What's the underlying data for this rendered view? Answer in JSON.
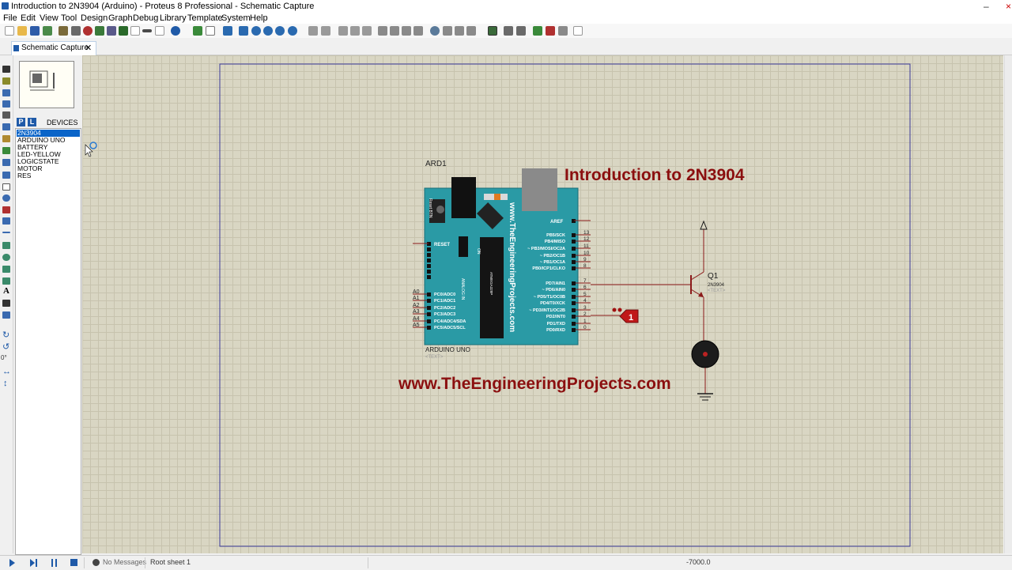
{
  "window": {
    "title": "Introduction to 2N3904 (Arduino) - Proteus 8 Professional - Schematic Capture"
  },
  "menu": [
    "File",
    "Edit",
    "View",
    "Tool",
    "Design",
    "Graph",
    "Debug",
    "Library",
    "Template",
    "System",
    "Help"
  ],
  "tab": {
    "label": "Schematic Capture"
  },
  "panel": {
    "p_label": "P",
    "l_label": "L",
    "devices_title": "DEVICES",
    "devices": [
      "2N3904",
      "ARDUINO UNO",
      "BATTERY",
      "LED-YELLOW",
      "LOGICSTATE",
      "MOTOR",
      "RES"
    ],
    "selected": "2N3904",
    "angle": "0°"
  },
  "schematic": {
    "heading": "Introduction to 2N3904",
    "website": "www.TheEngineeringProjects.com",
    "board_ref": "ARD1",
    "board_name": "ARDUINO UNO",
    "board_text": "<TEXT>",
    "board_vertical_text": "www.TheEngineeringProjects.com",
    "reset_label": "RESET",
    "reset_btn_label": "Reset BTN",
    "on_label": "ON",
    "analog_header": "ANALOG IN",
    "chip_label": "ATMEGA328P",
    "aref": "AREF",
    "digital_labels": [
      "PB5/SCK",
      "PB4/MISO",
      "~ PB3/MOSI/OC2A",
      "~ PB2/OC1B",
      "~ PB1/OC1A",
      "PB0/ICP1/CLKO",
      "PD7/AIN1",
      "~ PD6/AIN0",
      "~ PD5/T1/OC0B",
      "PD4/T0/XCK",
      "~ PD3/INT1/OC2B",
      "PD2/INT0",
      "PD1/TXD",
      "PD0/RXD"
    ],
    "digital_nums": [
      "13",
      "12",
      "11",
      "10",
      "9",
      "8",
      "7",
      "6",
      "5",
      "4",
      "3",
      "2",
      "1",
      "0"
    ],
    "analog_pins": [
      "A0",
      "A1",
      "A2",
      "A3",
      "A4",
      "A5"
    ],
    "analog_labels": [
      "PC0/ADC0",
      "PC1/ADC1",
      "PC2/ADC2",
      "PC3/ADC3",
      "PC4/ADC4/SDA",
      "PC5/ADC5/SCL"
    ],
    "transistor_ref": "Q1",
    "transistor_part": "2N3904",
    "transistor_text": "<TEXT>",
    "logicstate_value": "1"
  },
  "status": {
    "messages": "No Messages",
    "sheet": "Root sheet 1",
    "coordinate": "-7000.0"
  },
  "colors": {
    "accent": "#0a64c8",
    "heading": "#8b0f0f",
    "board": "#2a9aa5",
    "wire": "#8b1a1a",
    "grid_bg": "#d9d6c3"
  }
}
